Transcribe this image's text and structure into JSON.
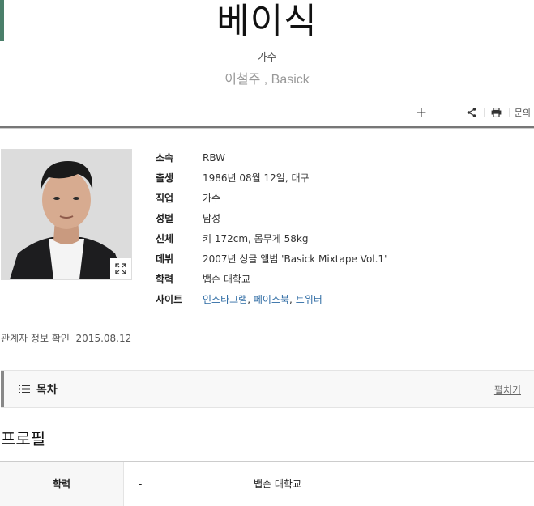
{
  "header": {
    "title": "베이식",
    "subtitle": "가수",
    "alias": "이철주 , Basick"
  },
  "toolbar": {
    "plus": "+",
    "minus": "—",
    "inquiry": "문의"
  },
  "profile": {
    "rows": [
      {
        "label": "소속",
        "value": "RBW"
      },
      {
        "label": "출생",
        "value": "1986년 08월 12일, 대구"
      },
      {
        "label": "직업",
        "value": "가수"
      },
      {
        "label": "성별",
        "value": "남성"
      },
      {
        "label": "신체",
        "value": "키 172cm, 몸무게 58kg"
      },
      {
        "label": "데뷔",
        "value": "2007년 싱글 앨범 'Basick Mixtape Vol.1'"
      },
      {
        "label": "학력",
        "value": "뱁슨 대학교"
      }
    ],
    "site": {
      "label": "사이트",
      "links": [
        "인스타그램",
        "페이스북",
        "트위터"
      ],
      "separator": ","
    }
  },
  "confirmation": "관계자 정보 확인  2015.08.12",
  "toc": {
    "label": "목차",
    "toggle": "펼치기"
  },
  "section": {
    "title": "프로필",
    "table": [
      {
        "label": "학력",
        "period": "-",
        "detail": "뱁슨 대학교"
      }
    ]
  },
  "icons": {
    "share": "share-icon",
    "print": "print-icon",
    "expand": "expand-icon",
    "toc": "list-icon"
  },
  "colors": {
    "accent": "#4a7f6a",
    "link": "#2c6aa3"
  }
}
